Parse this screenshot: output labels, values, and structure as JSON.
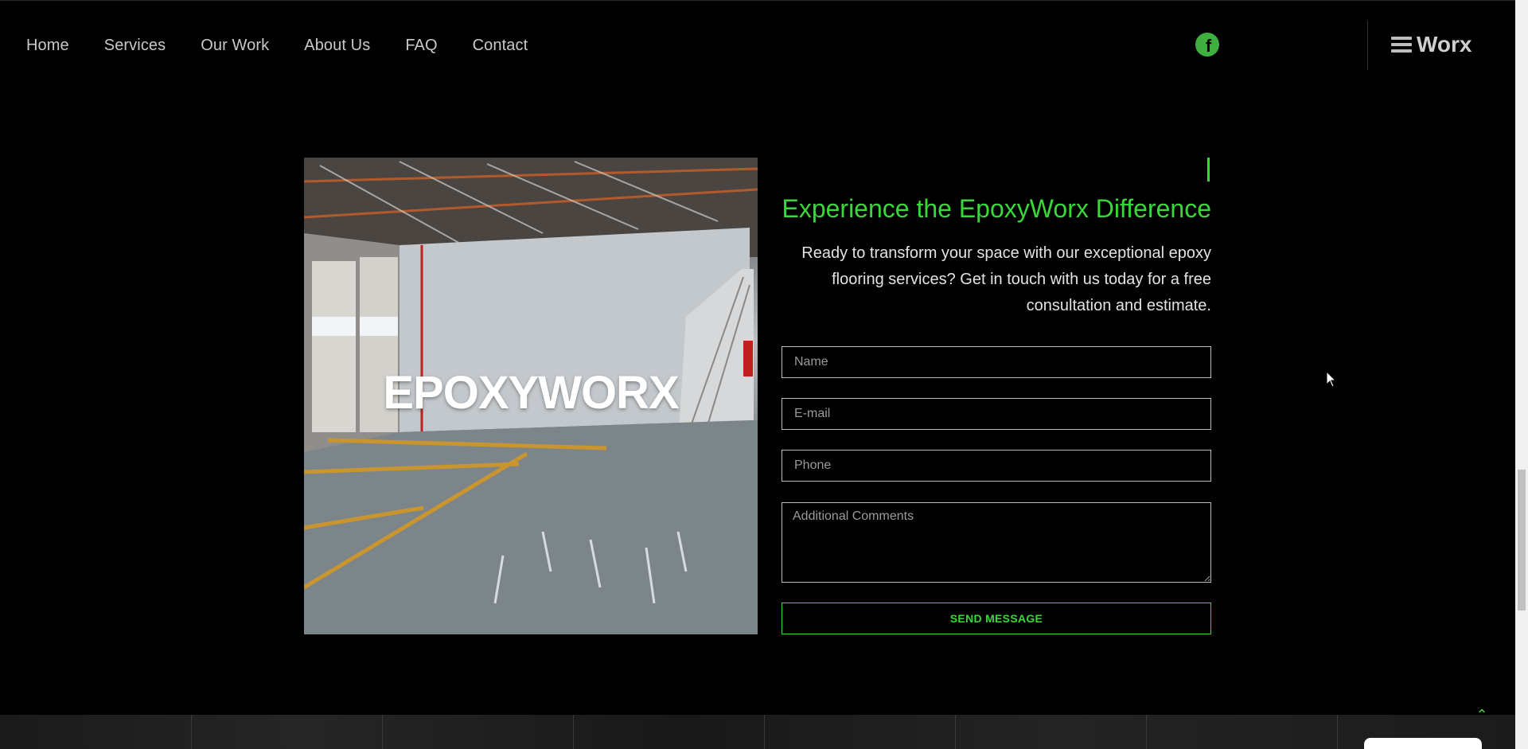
{
  "nav": {
    "items": [
      "Home",
      "Services",
      "Our Work",
      "About Us",
      "FAQ",
      "Contact"
    ]
  },
  "social": {
    "facebook_icon": "facebook-icon"
  },
  "brand": {
    "text": "Worx",
    "icon": "hamburger-icon"
  },
  "hero": {
    "image_text": "EPOXYWORX"
  },
  "contact": {
    "headline": "Experience the EpoxyWorx Difference",
    "blurb": "Ready to transform your space with our exceptional epoxy flooring services? Get in touch with us today for a free consultation and estimate.",
    "name_placeholder": "Name",
    "email_placeholder": "E-mail",
    "phone_placeholder": "Phone",
    "comments_placeholder": "Additional Comments",
    "submit_label": "SEND MESSAGE"
  },
  "back_to_top_icon": "chevron-up-icon",
  "colors": {
    "accent": "#39d739",
    "background": "#000000",
    "nav_text": "#c9c9c9"
  }
}
